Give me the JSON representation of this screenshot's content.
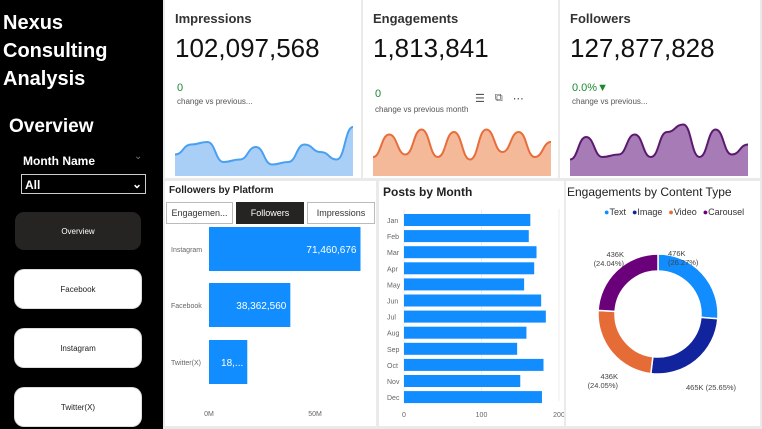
{
  "sidebar": {
    "app_title": "Nexus Consulting Analysis",
    "section_title": "Overview",
    "slicer_label": "Month Name",
    "slicer_value": "All",
    "nav": [
      {
        "label": "Overview",
        "active": true
      },
      {
        "label": "Facebook",
        "active": false
      },
      {
        "label": "Instagram",
        "active": false
      },
      {
        "label": "Twitter(X)",
        "active": false
      }
    ]
  },
  "kpis": [
    {
      "title": "Impressions",
      "value": "102,097,568",
      "change": "0",
      "sub": "change vs previous...",
      "color": "#4aa0f0",
      "fill": "#a9cff7",
      "spark": [
        0.35,
        0.55,
        0.6,
        0.2,
        0.25,
        0.5,
        0.15,
        0.2,
        0.55,
        0.4,
        0.25,
        0.9
      ]
    },
    {
      "title": "Engagements",
      "value": "1,813,841",
      "change": "0",
      "sub": "change vs previous month",
      "color": "#e86d3a",
      "fill": "#f3b999",
      "spark": [
        0.3,
        0.75,
        0.35,
        0.85,
        0.3,
        0.8,
        0.25,
        0.85,
        0.4,
        0.8,
        0.3,
        0.6
      ]
    },
    {
      "title": "Followers",
      "value": "127,877,828",
      "change": "0.0%▼",
      "sub": "change vs previous...",
      "color": "#5b1a6e",
      "fill": "#a67bb6",
      "spark": [
        0.25,
        0.7,
        0.3,
        0.35,
        0.75,
        0.3,
        0.8,
        0.95,
        0.3,
        0.85,
        0.35,
        0.55
      ]
    }
  ],
  "toolbar_icons": [
    "filter-icon",
    "focus-mode-icon",
    "more-options-icon"
  ],
  "followers_by_platform": {
    "title": "Followers by Platform",
    "tabs": [
      {
        "label": "Engagemen...",
        "active": false
      },
      {
        "label": "Followers",
        "active": true
      },
      {
        "label": "Impressions",
        "active": false
      }
    ],
    "axis_ticks": [
      "0M",
      "50M"
    ],
    "color": "#118dff"
  },
  "posts_by_month": {
    "title": "Posts by Month",
    "axis_ticks": [
      "0",
      "100",
      "200"
    ],
    "color": "#118dff"
  },
  "engagements_by_type": {
    "title": "Engagements by Content Type",
    "legend": [
      {
        "label": "Text",
        "color": "#118dff"
      },
      {
        "label": "Image",
        "color": "#12239e"
      },
      {
        "label": "Video",
        "color": "#e66c37"
      },
      {
        "label": "Carousel",
        "color": "#6b007b"
      }
    ]
  },
  "chart_data": [
    {
      "type": "bar",
      "title": "Followers by Platform",
      "categories": [
        "Instagram",
        "Facebook",
        "Twitter(X)"
      ],
      "values": [
        71460676,
        38362560,
        18054592
      ],
      "value_labels": [
        "71,460,676",
        "38,362,560",
        "18,..."
      ],
      "xlim": [
        0,
        80000000
      ]
    },
    {
      "type": "bar",
      "title": "Posts by Month",
      "categories": [
        "Jan",
        "Feb",
        "Mar",
        "Apr",
        "May",
        "Jun",
        "Jul",
        "Aug",
        "Sep",
        "Oct",
        "Nov",
        "Dec"
      ],
      "values": [
        163,
        161,
        171,
        168,
        155,
        177,
        183,
        158,
        146,
        180,
        150,
        178
      ],
      "xlim": [
        0,
        200
      ]
    },
    {
      "type": "pie",
      "title": "Engagements by Content Type",
      "categories": [
        "Text",
        "Image",
        "Video",
        "Carousel"
      ],
      "values": [
        476,
        465,
        436,
        436
      ],
      "value_labels": [
        "476K\n(26.27%)",
        "465K (25.65%)",
        "436K\n(24.05%)",
        "436K\n(24.04%)"
      ]
    }
  ]
}
